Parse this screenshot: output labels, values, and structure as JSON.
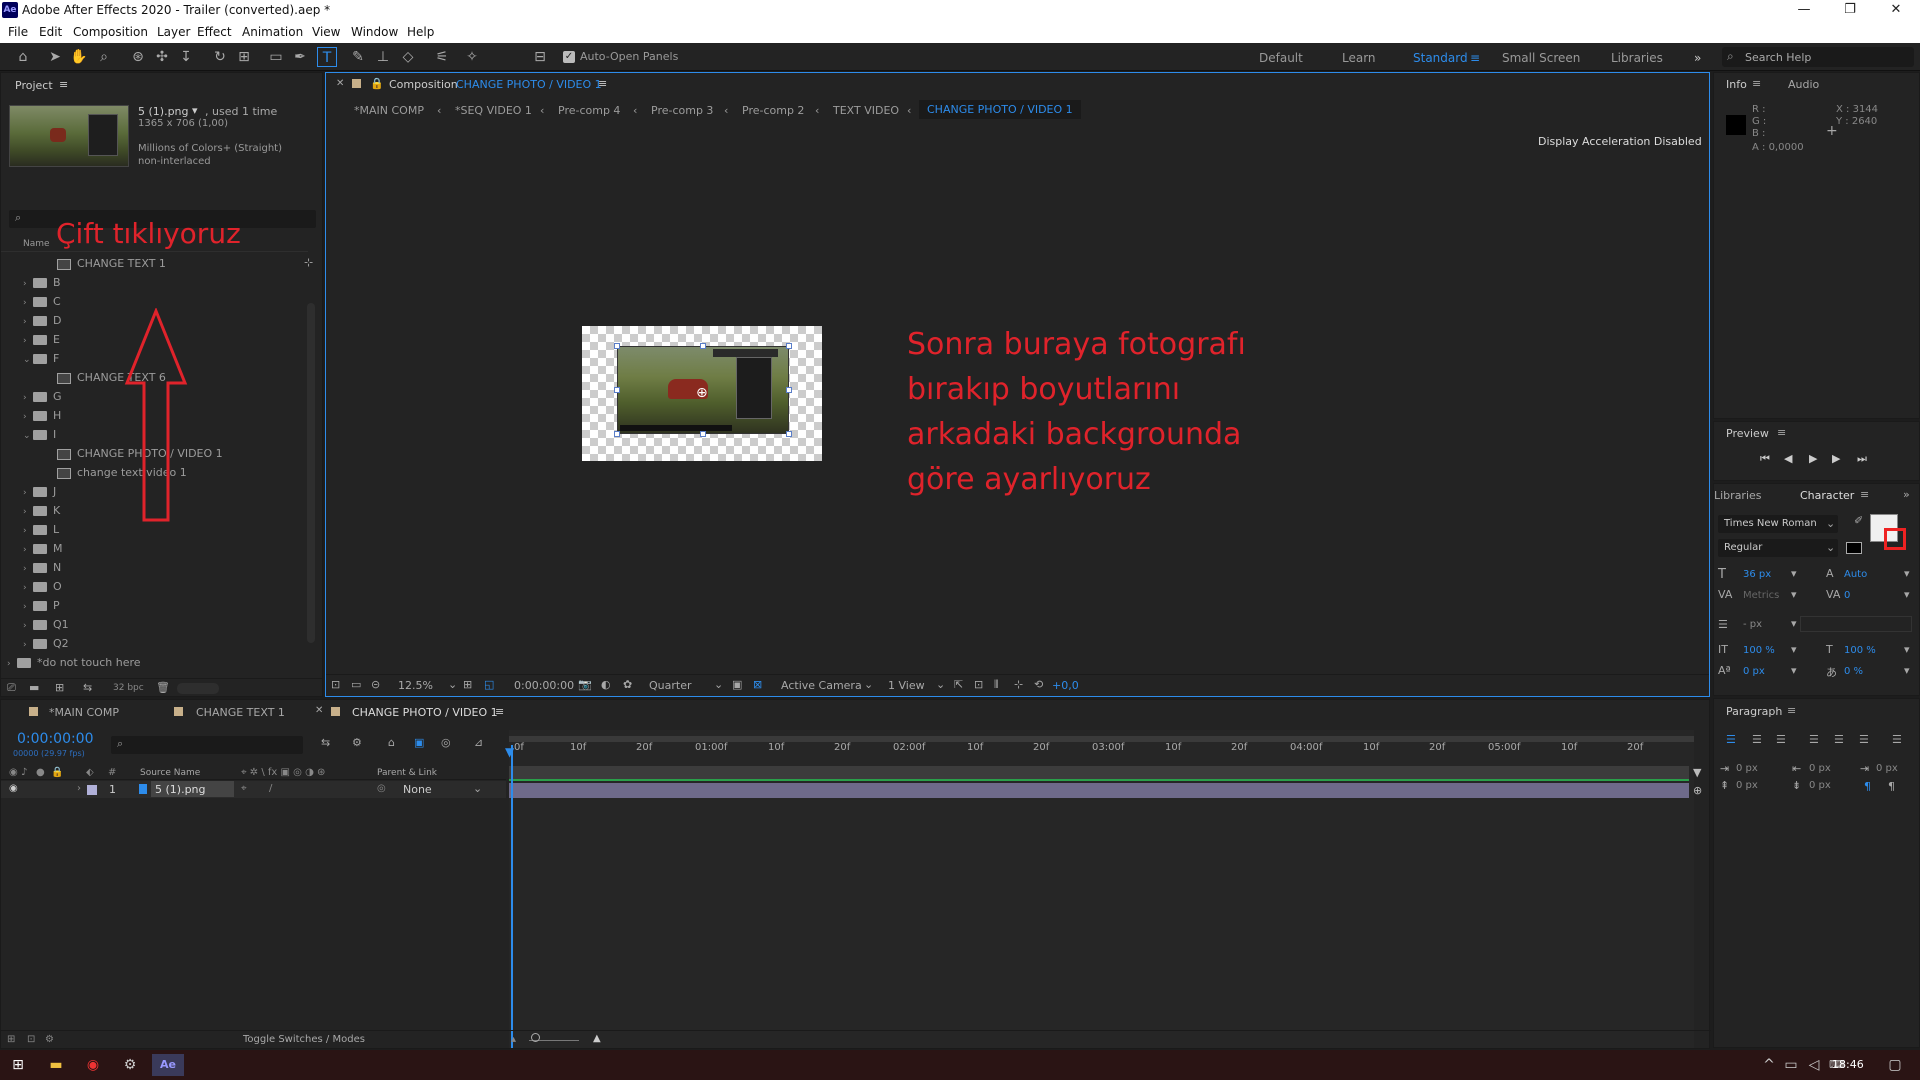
{
  "titlebar": {
    "app_icon": "Ae",
    "title": "Adobe After Effects 2020 - Trailer (converted).aep *",
    "minimize": "—",
    "maximize": "❐",
    "close": "✕"
  },
  "menu": [
    "File",
    "Edit",
    "Composition",
    "Layer",
    "Effect",
    "Animation",
    "View",
    "Window",
    "Help"
  ],
  "toolbar": {
    "auto_open": "Auto-Open Panels",
    "workspaces": [
      "Default",
      "Learn",
      "Standard",
      "Small Screen",
      "Libraries"
    ],
    "active_workspace": "Standard",
    "search_placeholder": "Search Help"
  },
  "project": {
    "title": "Project",
    "item_name": "5 (1).png",
    "item_used": ", used 1 time",
    "item_dims": "1365 x 706 (1,00)",
    "item_colors": "Millions of Colors+ (Straight)",
    "item_interlace": "non-interlaced",
    "name_header": "Name",
    "rows": [
      "CHANGE TEXT 1",
      "B",
      "C",
      "D",
      "E",
      "F",
      "CHANGE TEXT 6",
      "G",
      "H",
      "I",
      "CHANGE PHOTO / VIDEO 1",
      "change text video 1",
      "J",
      "K",
      "L",
      "M",
      "N",
      "O",
      "P",
      "Q1",
      "Q2",
      "*do not touch here"
    ],
    "bpc": "32 bpc"
  },
  "composition": {
    "label": "Composition",
    "name": "CHANGE PHOTO / VIDEO 1",
    "breadcrumbs": [
      "*MAIN COMP",
      "*SEQ VIDEO 1",
      "Pre-comp 4",
      "Pre-comp 3",
      "Pre-comp 2",
      "TEXT VIDEO",
      "CHANGE PHOTO / VIDEO 1"
    ],
    "display_msg": "Display Acceleration Disabled",
    "zoom": "12.5%",
    "time": "0:00:00:00",
    "resolution": "Quarter",
    "camera": "Active Camera",
    "view": "1 View",
    "exposure": "+0,0"
  },
  "annotations": {
    "double_click": "Çift tıklıyoruz",
    "instruction_lines": [
      "Sonra buraya fotografı",
      "bırakıp boyutlarını",
      "arkadaki backgrounda",
      "göre ayarlıyoruz"
    ]
  },
  "info": {
    "tab": "Info",
    "audio": "Audio",
    "r": "R :",
    "g": "G :",
    "b": "B :",
    "a": "A : 0,0000",
    "x": "X : 3144",
    "y": "Y : 2640"
  },
  "preview": {
    "title": "Preview"
  },
  "character": {
    "libraries": "Libraries",
    "title": "Character",
    "font": "Times New Roman",
    "style": "Regular",
    "size": "36 px",
    "leading": "Auto",
    "kerning": "Metrics",
    "tracking": "0",
    "stroke": "- px",
    "vscale": "100 %",
    "hscale": "100 %",
    "baseline": "0 px",
    "tsume": "0 %"
  },
  "paragraph": {
    "title": "Paragraph",
    "values": [
      "0 px",
      "0 px",
      "0 px",
      "0 px",
      "0 px"
    ]
  },
  "timeline": {
    "tabs": [
      "*MAIN COMP",
      "CHANGE TEXT 1",
      "CHANGE PHOTO / VIDEO 1"
    ],
    "time": "0:00:00:00",
    "fps": "00000 (29.97 fps)",
    "source_header": "Source Name",
    "parent_header": "Parent & Link",
    "layer_num": "1",
    "layer_name": "5 (1).png",
    "parent_value": "None",
    "ticks": [
      "0f",
      "10f",
      "20f",
      "01:00f",
      "10f",
      "20f",
      "02:00f",
      "10f",
      "20f",
      "03:00f",
      "10f",
      "20f",
      "04:00f",
      "10f",
      "20f",
      "05:00f",
      "10f",
      "20f"
    ],
    "toggle": "Toggle Switches / Modes"
  },
  "taskbar": {
    "time": "18:46"
  },
  "colors": {
    "accent": "#2d8ceb",
    "annotation": "#e0232b",
    "layer_bar": "#6e6a8a"
  }
}
